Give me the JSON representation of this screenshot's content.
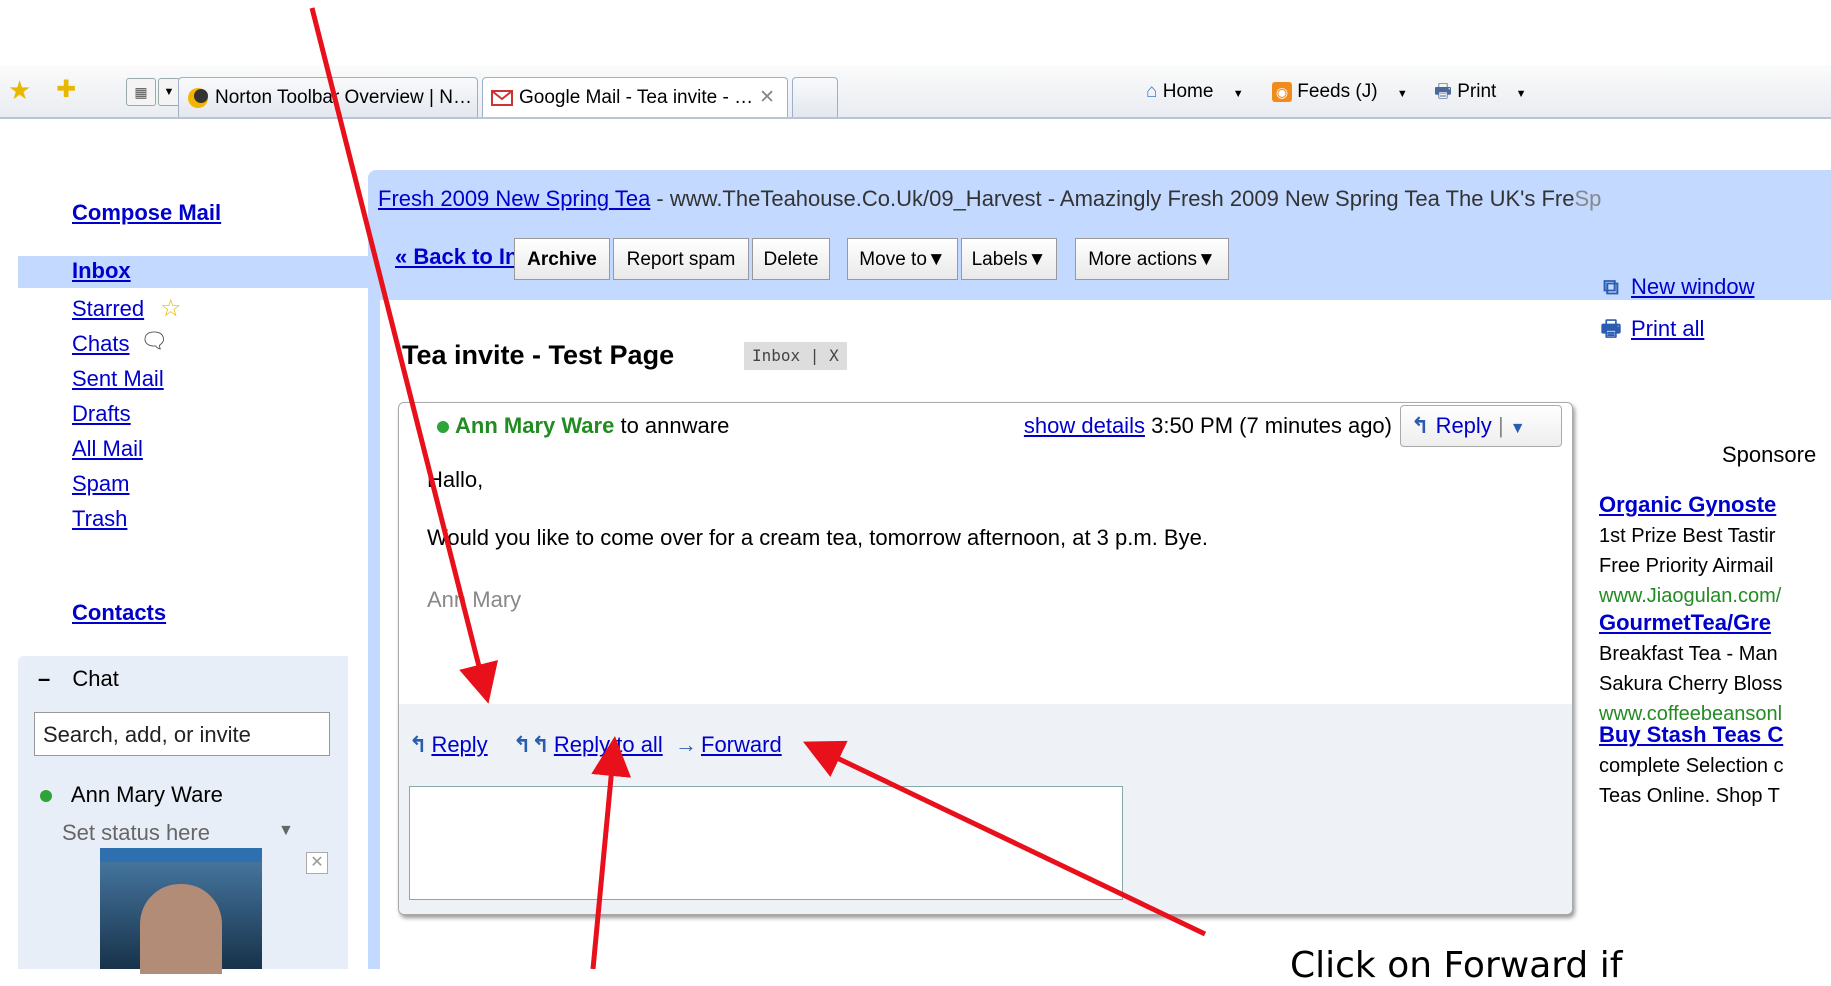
{
  "browser": {
    "tabs": [
      {
        "label": "Norton Toolbar Overview | N…",
        "active": false
      },
      {
        "label": "Google Mail - Tea invite - …",
        "active": true
      }
    ],
    "commands": {
      "home": "Home",
      "feeds": "Feeds (J)",
      "print": "Print"
    }
  },
  "nav": {
    "compose": "Compose Mail",
    "inbox": "Inbox",
    "items": [
      "Starred",
      "Chats",
      "Sent Mail",
      "Drafts",
      "All Mail",
      "Spam",
      "Trash"
    ],
    "contacts": "Contacts"
  },
  "chat": {
    "title": "Chat",
    "search_placeholder": "Search, add, or invite",
    "contact": "Ann Mary Ware",
    "status": "Set status here"
  },
  "ad_line": {
    "link": "Fresh 2009 New Spring Tea",
    "text": " - www.TheTeahouse.Co.Uk/09_Harvest - Amazingly Fresh 2009 New Spring Tea The UK's Fre",
    "sp": "Sp"
  },
  "toolbar": {
    "back": "« Back to Inbox",
    "archive": "Archive",
    "report_spam": "Report spam",
    "delete": "Delete",
    "move_to": "Move to▼",
    "labels": "Labels▼",
    "more_actions": "More actions▼"
  },
  "message": {
    "subject": "Tea invite - Test Page",
    "label": "Inbox | X",
    "sender": "Ann Mary Ware",
    "recipient": "to annware",
    "show_details": "show details",
    "time": "3:50 PM (7 minutes ago)",
    "reply_button": "Reply",
    "greeting": "Hallo,",
    "body": "Would you like to come over for a cream tea, tomorrow afternoon, at 3 p.m.  Bye.",
    "signature": "Ann Mary"
  },
  "reply_actions": {
    "reply": "Reply",
    "reply_all": "Reply to all",
    "forward": "Forward"
  },
  "right": {
    "new_window": "New window",
    "print_all": "Print all",
    "sponsored": "Sponsore",
    "ads": [
      {
        "title": "Organic Gynoste",
        "lines": [
          "1st Prize Best Tastir",
          "Free Priority Airmail"
        ],
        "url": "www.Jiaogulan.com/"
      },
      {
        "title": "GourmetTea/Gre",
        "lines": [
          "Breakfast Tea - Man",
          "Sakura Cherry Bloss"
        ],
        "url": "www.coffeebeansonl"
      },
      {
        "title": "Buy Stash Teas C",
        "lines": [
          "complete Selection c",
          "Teas Online. Shop T"
        ],
        "url": ""
      }
    ]
  },
  "annotation": {
    "text": "Click on Forward if",
    "color": "#e8101a"
  }
}
